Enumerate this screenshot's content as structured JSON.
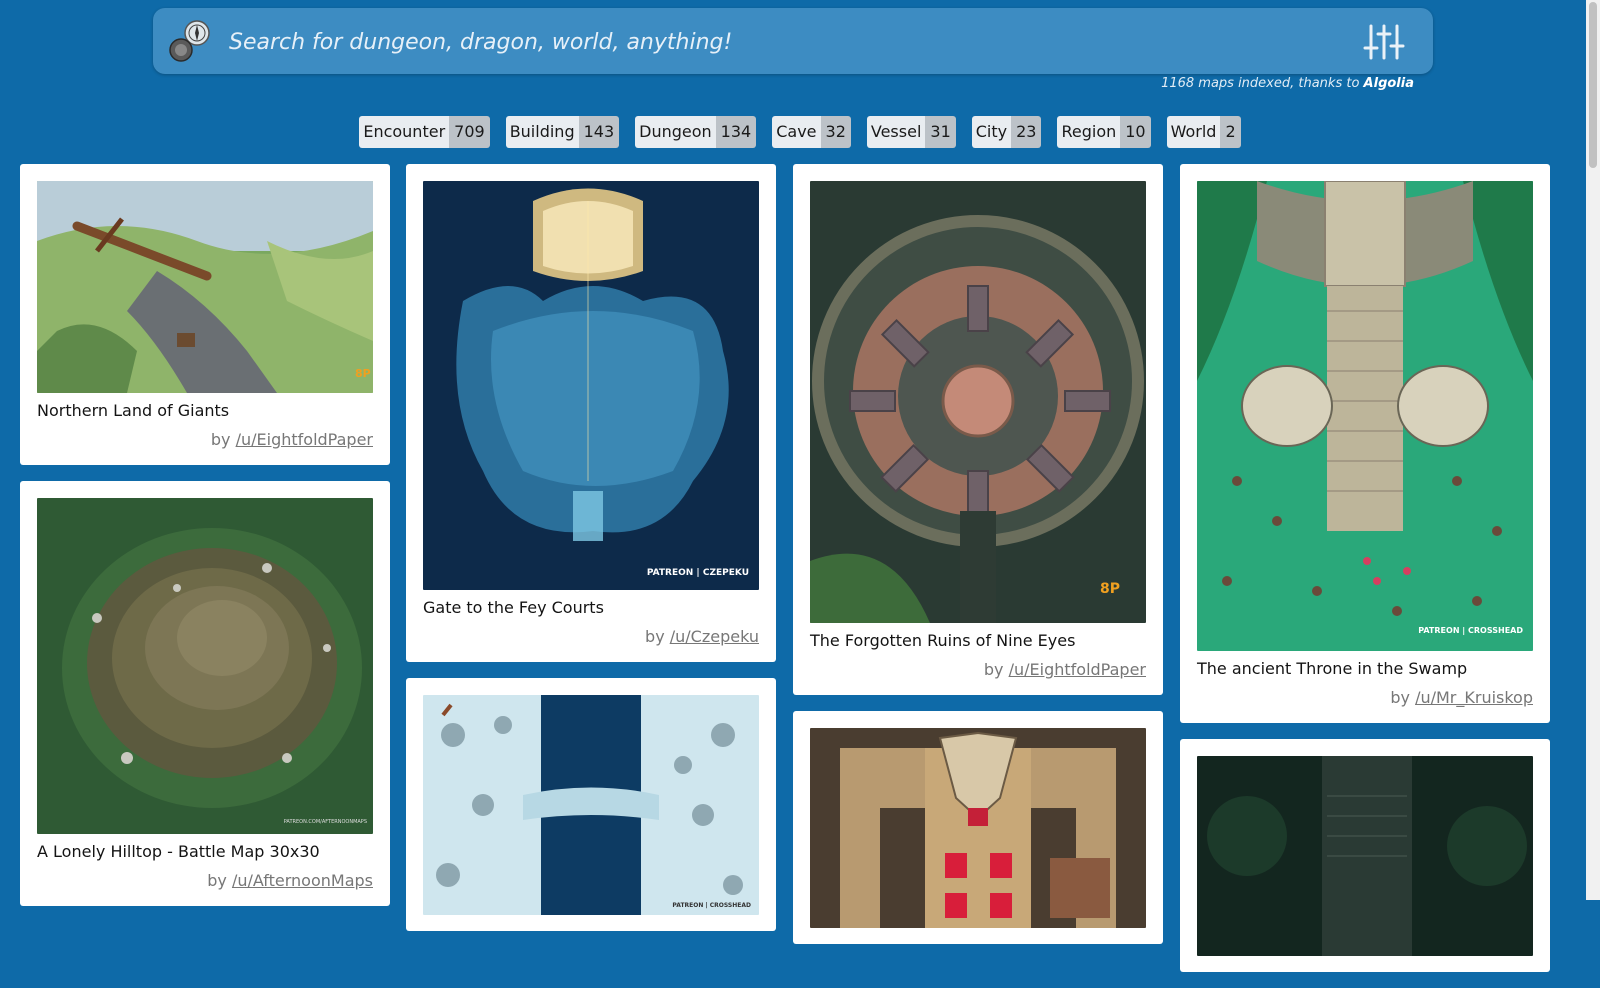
{
  "search": {
    "placeholder": "Search for dungeon, dragon, world, anything!",
    "index_prefix": "1168 maps indexed, thanks to ",
    "index_brand": "Algolia"
  },
  "categories": [
    {
      "label": "Encounter",
      "count": "709"
    },
    {
      "label": "Building",
      "count": "143"
    },
    {
      "label": "Dungeon",
      "count": "134"
    },
    {
      "label": "Cave",
      "count": "32"
    },
    {
      "label": "Vessel",
      "count": "31"
    },
    {
      "label": "City",
      "count": "23"
    },
    {
      "label": "Region",
      "count": "10"
    },
    {
      "label": "World",
      "count": "2"
    }
  ],
  "maps": [
    {
      "title": "Northern Land of Giants",
      "by": "by ",
      "author": "/u/EightfoldPaper",
      "watermark": "8P"
    },
    {
      "title": "A Lonely Hilltop - Battle Map 30x30",
      "by": "by ",
      "author": "/u/AfternoonMaps",
      "watermark": "PATREON.COM/AFTERNOONMAPS"
    },
    {
      "title": "Gate to the Fey Courts",
      "by": "by ",
      "author": "/u/Czepeku",
      "watermark": "PATREON | CZEPEKU"
    },
    {
      "title": "",
      "watermark": "PATREON | CROSSHEAD"
    },
    {
      "title": "The Forgotten Ruins of Nine Eyes",
      "by": "by ",
      "author": "/u/EightfoldPaper",
      "watermark": "8P"
    },
    {
      "title": ""
    },
    {
      "title": "The ancient Throne in the Swamp",
      "by": "by ",
      "author": "/u/Mr_Kruiskop",
      "watermark": "PATREON | CROSSHEAD"
    },
    {
      "title": ""
    }
  ],
  "colors": {
    "background": "#0e6aa8",
    "search_bar": "#3d8cc2",
    "card": "#ffffff",
    "chip": "#e9edf1",
    "chip_count": "#bcc2c8"
  }
}
